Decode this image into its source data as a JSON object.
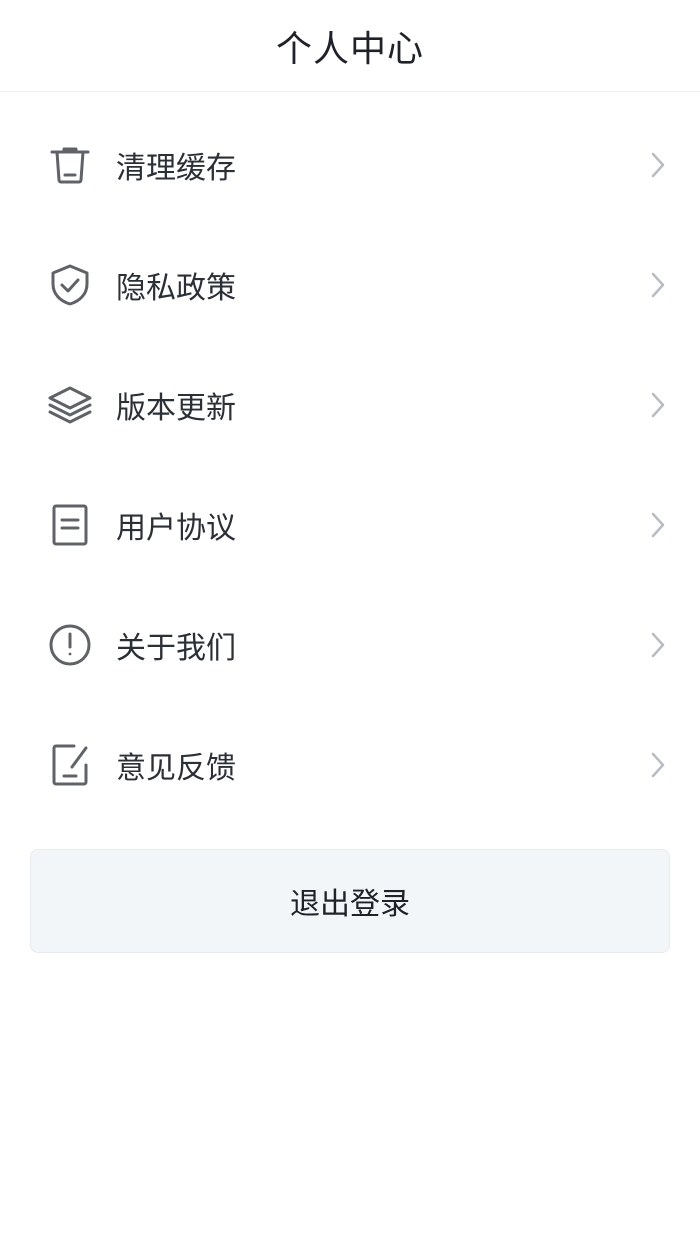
{
  "header": {
    "title": "个人中心"
  },
  "menu": {
    "items": [
      {
        "label": "清理缓存",
        "icon": "trash-icon"
      },
      {
        "label": "隐私政策",
        "icon": "shield-check-icon"
      },
      {
        "label": "版本更新",
        "icon": "layers-icon"
      },
      {
        "label": "用户协议",
        "icon": "document-icon"
      },
      {
        "label": "关于我们",
        "icon": "info-circle-icon"
      },
      {
        "label": "意见反馈",
        "icon": "edit-note-icon"
      }
    ]
  },
  "actions": {
    "logout_label": "退出登录"
  },
  "colors": {
    "icon_stroke": "#5f6368",
    "chevron": "#b8bcc3",
    "button_bg": "#f3f6f9",
    "text": "#2b2f36"
  }
}
